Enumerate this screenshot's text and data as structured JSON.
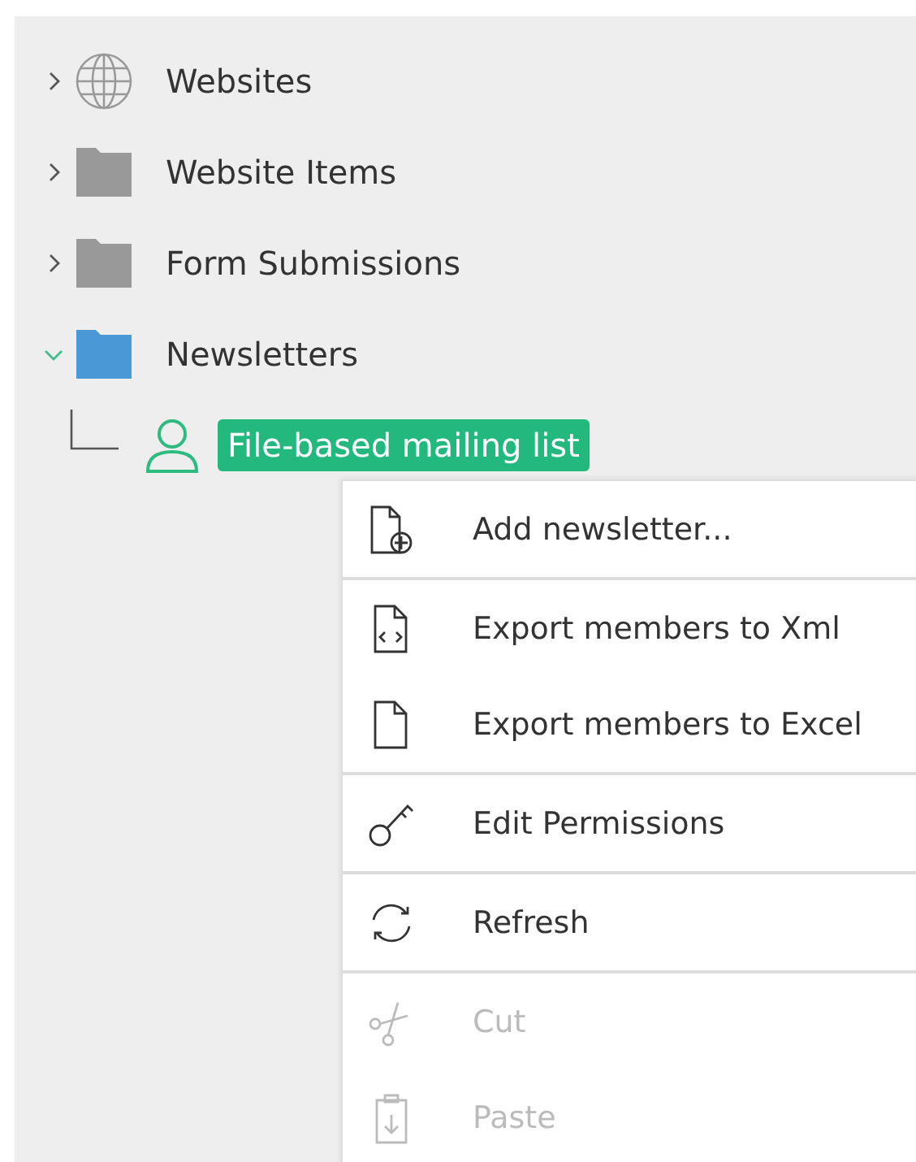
{
  "tree": [
    {
      "label": "Websites",
      "kind": "globe",
      "expanded": false,
      "selected": false
    },
    {
      "label": "Website Items",
      "kind": "folder",
      "expanded": false,
      "selected": false
    },
    {
      "label": "Form Submissions",
      "kind": "folder",
      "expanded": false,
      "selected": false
    },
    {
      "label": "Newsletters",
      "kind": "folder",
      "expanded": true,
      "selected": false,
      "children": [
        {
          "label": "File-based mailing list",
          "kind": "person",
          "selected": true
        }
      ]
    }
  ],
  "context_menu": {
    "groups": [
      [
        {
          "label": "Add newsletter...",
          "kind": "add",
          "disabled": false
        }
      ],
      [
        {
          "label": "Export members to Xml",
          "kind": "xml",
          "disabled": false
        },
        {
          "label": "Export members to Excel",
          "kind": "excel",
          "disabled": false
        }
      ],
      [
        {
          "label": "Edit Permissions",
          "kind": "permissions",
          "disabled": false
        }
      ],
      [
        {
          "label": "Refresh",
          "kind": "refresh",
          "disabled": false
        }
      ],
      [
        {
          "label": "Cut",
          "kind": "cut",
          "disabled": true
        },
        {
          "label": "Paste",
          "kind": "paste",
          "disabled": true
        }
      ]
    ]
  }
}
